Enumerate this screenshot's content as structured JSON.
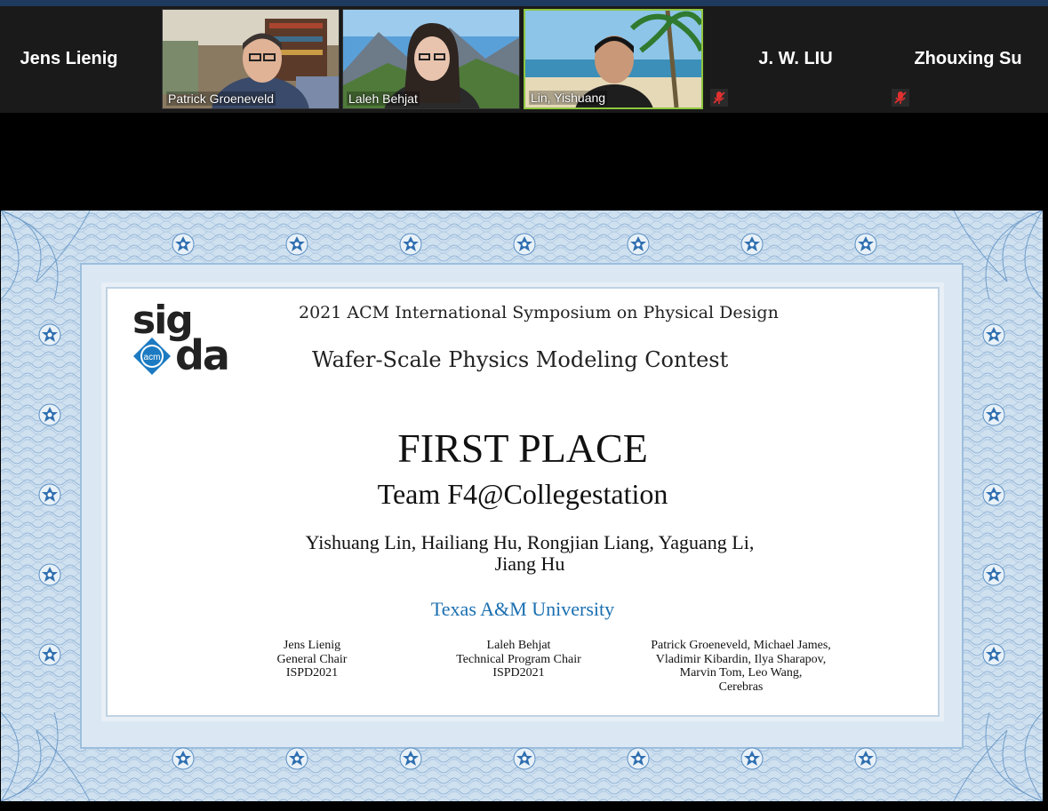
{
  "participants": {
    "jens": {
      "name": "Jens Lienig"
    },
    "patrick": {
      "name": "Patrick Groeneveld"
    },
    "laleh": {
      "name": "Laleh Behjat"
    },
    "lin": {
      "name": "Lin, Yishuang"
    },
    "liu": {
      "name": "J. W. LIU"
    },
    "zhouxing": {
      "name": "Zhouxing Su"
    }
  },
  "certificate": {
    "logo_sig": "sig",
    "logo_da": "da",
    "logo_acm": "acm",
    "symposium": "2021 ACM International Symposium on Physical Design",
    "contest": "Wafer-Scale Physics Modeling Contest",
    "award": "FIRST PLACE",
    "team": "Team F4@Collegestation",
    "authors_line1": "Yishuang Lin, Hailiang Hu, Rongjian Liang, Yaguang Li,",
    "authors_line2": "Jiang Hu",
    "university": "Texas A&M University",
    "signatory1": {
      "l1": "Jens Lienig",
      "l2": "General Chair",
      "l3": "ISPD2021"
    },
    "signatory2": {
      "l1": "Laleh Behjat",
      "l2": "Technical Program Chair",
      "l3": "ISPD2021"
    },
    "signatory3": {
      "l1": "Patrick Groeneveld, Michael James,",
      "l2": "Vladimir Kibardin, Ilya Sharapov,",
      "l3": "Marvin Tom, Leo Wang,",
      "l4": "Cerebras"
    }
  },
  "colors": {
    "active_speaker_border": "#8dc63f",
    "university_text": "#1a6fb0",
    "mic_muted": "#e03030"
  },
  "icons": {
    "muted_mic": "mic-muted-icon",
    "acm": "acm-logo-icon"
  }
}
